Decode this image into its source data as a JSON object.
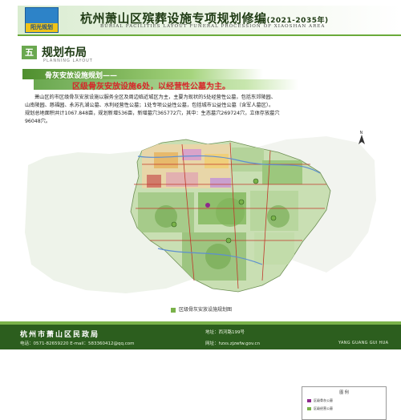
{
  "header": {
    "logo_text": "阳光规划",
    "title": "杭州萧山区殡葬设施专项规划修编",
    "title_years": "(2021-2035年)",
    "subtitle": "BURIAL FACILITIES LAYOUT FUNERAL PROCESSION OF XIAOSHAN AREA"
  },
  "section": {
    "number": "五",
    "title": "规划布局",
    "subtitle": "PLANNING LAYOUT"
  },
  "banner": {
    "line1": "骨灰安放设施规划——",
    "line2": "区级骨灰安放设施6处，以经营性公墓为主。"
  },
  "paragraph": {
    "line1": "萧山区的市区级骨灰安放设施以服务全区及周边临近城区为主，主要为现状的5处经营性公墓，包括东郊陵园、",
    "line2": "山南陵园、慈福园、永苏孔湖公墓、水利经营性公墓；1处专项公益性公墓，包括城市公益性公墓（含军人墓区）。",
    "line3": "规划总地面积共计1067.848亩，规划新增536亩，新增墓穴365772穴，其中：生态墓穴269724穴，立体存放墓穴",
    "line4": "96048穴。"
  },
  "map": {
    "legend_title": "图    例",
    "legend_items": [
      "区级骨灰公墓",
      "区级经营公墓"
    ],
    "legend_colors": [
      "#8e2a8c",
      "#7ab24a"
    ],
    "caption": "区级骨灰安放设施规划图"
  },
  "footer": {
    "org": "杭州市萧山区民政局",
    "address": "地址：西河路199号",
    "contact": "电话：0571-82659220        E-mail：583360412@qq.com",
    "website": "网址：hzxs.zjzwfw.gov.cn",
    "brand": "YANG GUANG GUI HUA"
  }
}
